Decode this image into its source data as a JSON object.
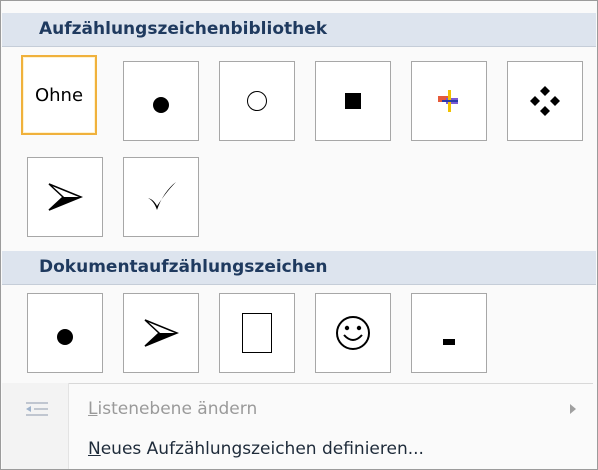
{
  "library": {
    "title": "Aufzählungszeichenbibliothek",
    "none_label": "Ohne",
    "bullets": [
      {
        "name": "none",
        "selected": true
      },
      {
        "name": "filled-circle-bullet"
      },
      {
        "name": "hollow-circle-bullet"
      },
      {
        "name": "filled-square-bullet"
      },
      {
        "name": "colored-cross-bullet"
      },
      {
        "name": "four-diamond-bullet"
      },
      {
        "name": "arrowhead-bullet"
      },
      {
        "name": "checkmark-bullet"
      }
    ]
  },
  "document": {
    "title": "Dokumentaufzählungszeichen",
    "bullets": [
      {
        "name": "filled-circle-bullet"
      },
      {
        "name": "arrowhead-bullet"
      },
      {
        "name": "rectangle-bullet"
      },
      {
        "name": "smiley-bullet"
      },
      {
        "name": "dash-bullet"
      }
    ]
  },
  "commands": {
    "change_level": {
      "label_first": "L",
      "label_rest": "istenebene ändern",
      "enabled": false
    },
    "define_new": {
      "label_first": "N",
      "label_rest": "eues Aufzählungszeichen definieren...",
      "enabled": true
    }
  },
  "colors": {
    "header_bg": "#dde4ee",
    "header_text": "#1f3a5f",
    "selected_border": "#f0b13c"
  }
}
